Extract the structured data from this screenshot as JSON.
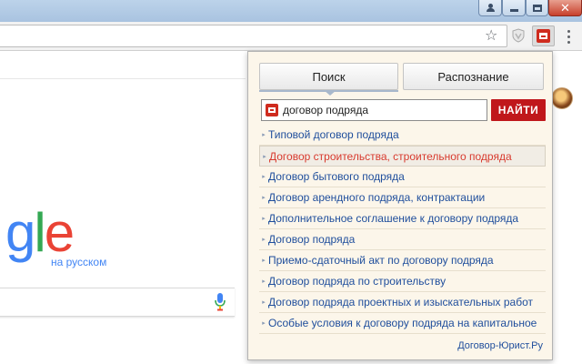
{
  "window": {
    "buttons": [
      {
        "name": "profile",
        "icon": "user-icon"
      },
      {
        "name": "minimize",
        "icon": "minimize-icon"
      },
      {
        "name": "maximize",
        "icon": "maximize-icon"
      },
      {
        "name": "close",
        "icon": "close-icon",
        "label": "✕"
      }
    ]
  },
  "toolbar": {
    "bookmark_icon": "star-icon",
    "bookmark_glyph": "☆",
    "extensions": [
      "shield-icon",
      "dogovor-extension-icon"
    ],
    "menu_icon": "more-vert-icon"
  },
  "page": {
    "logo_parts": [
      "g",
      "l",
      "e"
    ],
    "logo_colors": {
      "g": "#4285f4",
      "l": "#34a853",
      "e": "#ea4335"
    },
    "logo_subtitle": "на русском",
    "mic_icon": "microphone-icon"
  },
  "popup": {
    "tabs": [
      {
        "label": "Поиск",
        "active": true
      },
      {
        "label": "Распознание",
        "active": false
      }
    ],
    "search": {
      "query": "договор подряда",
      "button_label": "НАЙТИ"
    },
    "suggestions": [
      "Типовой договор подряда",
      "Договор строительства, строительного подряда",
      "Договор бытового подряда",
      "Договор арендного подряда, контрактации",
      "Дополнительное соглашение к договору подряда",
      "Договор подряда",
      "Приемо-сдаточный акт по договору подряда",
      "Договор подряда по строительству",
      "Договор подряда проектных и изыскательных работ",
      "Особые условия к договору подряда на капитальное"
    ],
    "highlighted_index": 1,
    "footer_link": "Договор-Юрист.Ру",
    "colors": {
      "accent_red": "#c0171b",
      "link_blue": "#1f4e9c",
      "highlight_red": "#d83a2e",
      "background": "#fcf6ea"
    }
  }
}
